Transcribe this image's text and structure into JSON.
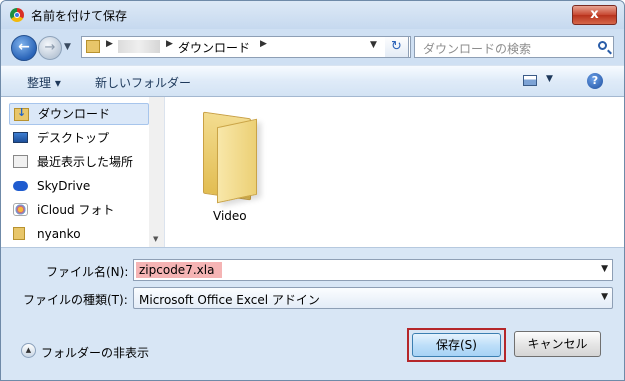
{
  "window": {
    "title": "名前を付けて保存",
    "close_label": "x"
  },
  "address": {
    "path_segment": "ダウンロード",
    "search_placeholder": "ダウンロードの検索"
  },
  "toolbar": {
    "organize_label": "整理 ▾",
    "new_folder_label": "新しいフォルダー"
  },
  "nav": {
    "items": [
      {
        "label": "ダウンロード",
        "icon": "download-folder-icon",
        "selected": true
      },
      {
        "label": "デスクトップ",
        "icon": "desktop-icon"
      },
      {
        "label": "最近表示した場所",
        "icon": "recent-places-icon"
      },
      {
        "label": "SkyDrive",
        "icon": "skydrive-cloud-icon"
      },
      {
        "label": "iCloud フォト",
        "icon": "icloud-photos-icon"
      },
      {
        "label": "nyanko",
        "icon": "folder-icon"
      }
    ]
  },
  "content": {
    "items": [
      {
        "label": "Video",
        "icon": "folder-icon"
      }
    ]
  },
  "form": {
    "filename_label": "ファイル名(N):",
    "filename_value": "zipcode7.xla",
    "filetype_label": "ファイルの種類(T):",
    "filetype_value": "Microsoft Office Excel アドイン"
  },
  "footer": {
    "hide_folders_label": "フォルダーの非表示",
    "save_label": "保存(S)",
    "cancel_label": "キャンセル"
  },
  "colors": {
    "highlight_frame": "#b5272a",
    "filename_highlight": "#f5b4b4"
  }
}
